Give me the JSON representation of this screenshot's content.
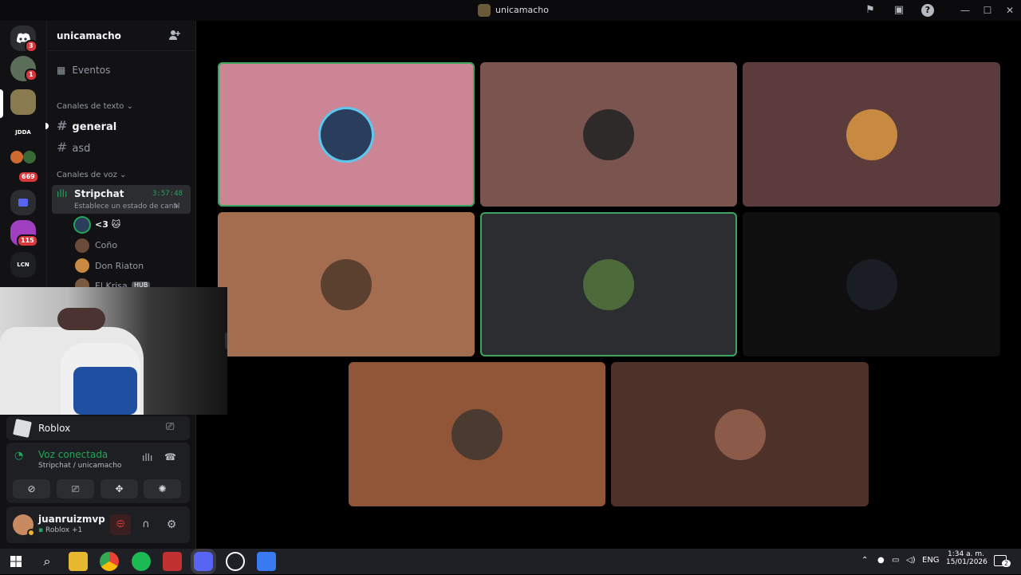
{
  "window": {
    "title": "unicamacho"
  },
  "guilds": {
    "home_badge": "3",
    "g1_badge": "1",
    "jdda_label": "JDDA",
    "g5_badge": "669",
    "g6_badge": "115",
    "lcn_label": "LCN"
  },
  "server": {
    "name": "unicamacho"
  },
  "sidebar": {
    "events_label": "Eventos",
    "text_category": "Canales de texto",
    "text_channels": [
      "general",
      "asd"
    ],
    "voice_category": "Canales de voz",
    "voice_channel": {
      "name": "Stripchat",
      "timer": "3:57:48",
      "status": "Establece un estado de canal"
    },
    "voice_members": [
      "<3 🐱",
      "Coño",
      "Don Riaton",
      "El Krisa"
    ],
    "hub_tag": "HUB"
  },
  "activity": {
    "name": "Roblox"
  },
  "voice": {
    "status": "Voz conectada",
    "location": "Stripchat / unicamacho"
  },
  "user": {
    "name": "juanruizmvp",
    "activity": "Roblox +1"
  },
  "tiles": [
    {
      "bg": "#cc8595",
      "speaking": true,
      "avatar": "#2a3d5c",
      "ring": "#5cc8f0"
    },
    {
      "bg": "#7a5550",
      "speaking": false,
      "avatar": "#2e2a2a"
    },
    {
      "bg": "#5b3b3b",
      "speaking": false,
      "avatar": "#c88a40"
    },
    {
      "bg": "#a56d50",
      "speaking": false,
      "avatar": "#5b4030"
    },
    {
      "bg": "#2b2d31",
      "speaking": true,
      "avatar": "#4c6a3a"
    },
    {
      "bg": "#0f0f10",
      "speaking": false,
      "avatar": "#1a1d24"
    },
    {
      "bg": "#905637",
      "speaking": false,
      "avatar": "#4a3a30"
    },
    {
      "bg": "#4e3229",
      "speaking": false,
      "avatar": "#8b5a48"
    }
  ],
  "taskbar": {
    "lang": "ENG",
    "time": "1:34 a. m.",
    "date": "15/01/2026",
    "notif_count": "2"
  },
  "colors": {
    "voice_green": "#23a55a",
    "speaking_border": "#3ba55d",
    "badge_red": "#da373c",
    "blurple": "#5865f2"
  }
}
